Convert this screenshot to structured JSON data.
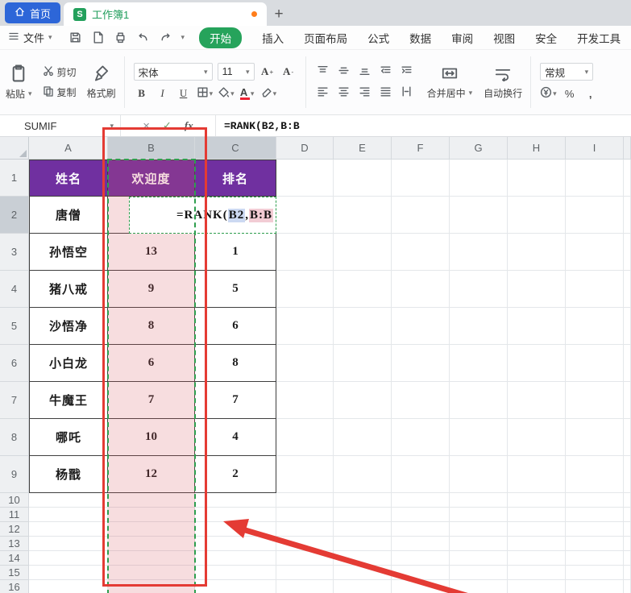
{
  "tab_bar": {
    "home_label": "首页",
    "doc_label": "工作簿1",
    "logo": "S",
    "new_tab": "+"
  },
  "menu": {
    "file": "文件",
    "tabs": [
      "开始",
      "插入",
      "页面布局",
      "公式",
      "数据",
      "审阅",
      "视图",
      "安全",
      "开发工具"
    ]
  },
  "toolbar": {
    "paste": "粘贴",
    "cut": "剪切",
    "copy": "复制",
    "format_painter": "格式刷",
    "font_name": "宋体",
    "font_size": "11",
    "bold": "B",
    "italic": "I",
    "underline": "U",
    "merge_center": "合并居中",
    "wrap_text": "自动换行",
    "number_format": "常规"
  },
  "formula_bar": {
    "name_box": "SUMIF",
    "cancel": "×",
    "confirm": "✓",
    "fx": "fx",
    "formula": "=RANK(B2,B:B"
  },
  "edit_cell": {
    "prefix": "=RANK(",
    "ref1": "B2",
    "comma": ",",
    "ref2": "B:B"
  },
  "sheet": {
    "col_letters": [
      "A",
      "B",
      "C",
      "D",
      "E",
      "F",
      "G",
      "H",
      "I"
    ],
    "row_count": 16,
    "table_headers": [
      "姓名",
      "欢迎度",
      "排名"
    ],
    "table_rows": [
      [
        "唐僧",
        "",
        ""
      ],
      [
        "孙悟空",
        "13",
        "1"
      ],
      [
        "猪八戒",
        "9",
        "5"
      ],
      [
        "沙悟净",
        "8",
        "6"
      ],
      [
        "小白龙",
        "6",
        "8"
      ],
      [
        "牛魔王",
        "7",
        "7"
      ],
      [
        "哪吒",
        "10",
        "4"
      ],
      [
        "杨戬",
        "12",
        "2"
      ]
    ]
  },
  "colors": {
    "header_purple": "#7030a0",
    "selection_pink": "rgba(214,84,96,0.20)",
    "ants_green": "#2e9e4e",
    "annotation_red": "#e43b34",
    "active_tab_green": "#26a35b",
    "home_tab_blue": "#2d66d8"
  }
}
